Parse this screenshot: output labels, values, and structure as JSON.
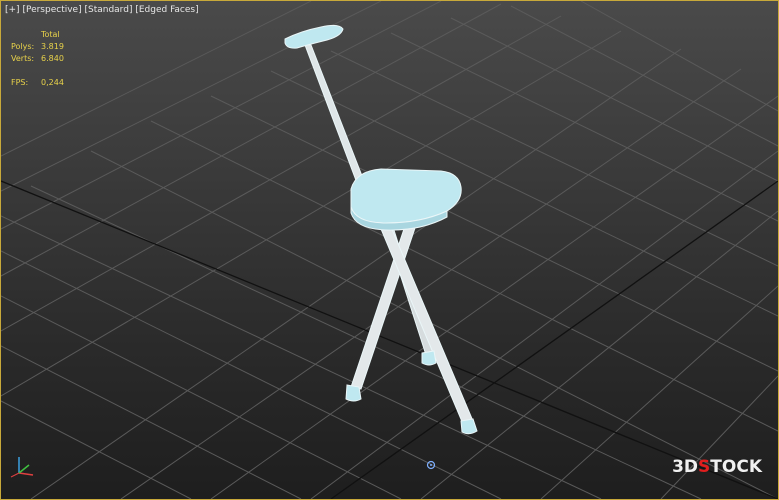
{
  "viewport": {
    "label_plus": "[+]",
    "label_view": "[Perspective]",
    "label_shading": "[Standard]",
    "label_edges": "[Edged Faces]"
  },
  "stats": {
    "header": "Total",
    "polys_label": "Polys:",
    "polys_value": "3.819",
    "verts_label": "Verts:",
    "verts_value": "6.840",
    "fps_label": "FPS:",
    "fps_value": "0,244",
    "color": "#e8d24a"
  },
  "model": {
    "name": "walking-cane-seat",
    "fill_color": "#bfe8f0",
    "edge_color": "#eaf6f8"
  },
  "watermark": {
    "prefix": "3D",
    "accent": "S",
    "suffix": "TOCK"
  },
  "colors": {
    "viewport_border": "#c8a93a",
    "grid": "#5a5a5a",
    "grid_axis": "#111111"
  },
  "icons": {
    "axis_gizmo": "axis-tripod-icon",
    "pivot": "pivot-point-icon"
  }
}
